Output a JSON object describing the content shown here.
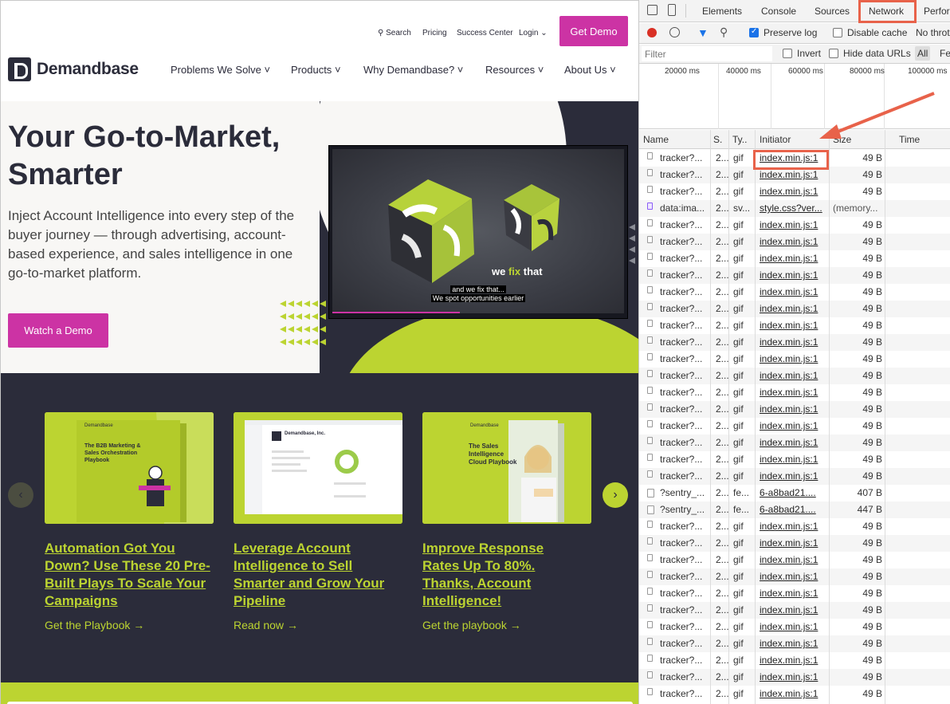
{
  "site": {
    "utility_nav": {
      "search": "Search",
      "pricing": "Pricing",
      "success_center": "Success Center",
      "login": "Login"
    },
    "get_demo_label": "Get Demo",
    "logo_text": "Demandbase",
    "nav": [
      "Problems We Solve",
      "Products",
      "Why Demandbase?",
      "Resources",
      "About Us"
    ],
    "hero": {
      "title": "Your Go-to-Market, Smarter",
      "subtitle": "Inject Account Intelligence into every step of the buyer journey — through advertising, account-based experience, and sales intelligence in one go-to-market platform.",
      "cta": "Watch a Demo"
    },
    "video": {
      "overlay_text_1": "we",
      "overlay_text_2": "fix",
      "overlay_text_3": "that",
      "caption_line_1": "and we fix that...",
      "caption_line_2": "We spot opportunities earlier"
    },
    "cards": [
      {
        "title": "Automation Got You Down? Use These 20 Pre-Built Plays To Scale Your Campaigns",
        "link": "Get the Playbook"
      },
      {
        "title": "Leverage Account Intelligence to Sell Smarter and Grow Your Pipeline",
        "link": "Read now"
      },
      {
        "title": "Improve Response Rates Up To 80%. Thanks, Account Intelligence!",
        "link": "Get the playbook"
      }
    ],
    "card_images": [
      {
        "brand": "Demandbase",
        "heading": "The B2B Marketing & Sales Orchestration Playbook"
      },
      {
        "brand": "Demandbase, Inc."
      },
      {
        "brand": "Demandbase",
        "heading": "The Sales Intelligence Cloud Playbook"
      }
    ]
  },
  "devtools": {
    "tabs": [
      "Elements",
      "Console",
      "Sources",
      "Network",
      "Perfor"
    ],
    "active_tab": "Network",
    "toolbar": {
      "preserve_log": "Preserve log",
      "disable_cache": "Disable cache",
      "throttle": "No throt"
    },
    "filter": {
      "placeholder": "Filter",
      "invert": "Invert",
      "hide_data_urls": "Hide data URLs",
      "all": "All",
      "fe": "Fe"
    },
    "timeline_ticks": [
      "20000 ms",
      "40000 ms",
      "60000 ms",
      "80000 ms",
      "100000 ms"
    ],
    "columns": [
      "Name",
      "S.",
      "Ty..",
      "Initiator",
      "Size",
      "Time"
    ],
    "rows": [
      {
        "name": "tracker?...",
        "status": "2...",
        "type": "gif",
        "initiator": "index.min.js:1",
        "size": "49 B",
        "icon": "image"
      },
      {
        "name": "tracker?...",
        "status": "2...",
        "type": "gif",
        "initiator": "index.min.js:1",
        "size": "49 B",
        "icon": "image"
      },
      {
        "name": "tracker?...",
        "status": "2...",
        "type": "gif",
        "initiator": "index.min.js:1",
        "size": "49 B",
        "icon": "image"
      },
      {
        "name": "data:ima...",
        "status": "2...",
        "type": "sv...",
        "initiator": "style.css?ver...",
        "size": "(memory...",
        "icon": "svg"
      },
      {
        "name": "tracker?...",
        "status": "2...",
        "type": "gif",
        "initiator": "index.min.js:1",
        "size": "49 B",
        "icon": "image"
      },
      {
        "name": "tracker?...",
        "status": "2...",
        "type": "gif",
        "initiator": "index.min.js:1",
        "size": "49 B",
        "icon": "image"
      },
      {
        "name": "tracker?...",
        "status": "2...",
        "type": "gif",
        "initiator": "index.min.js:1",
        "size": "49 B",
        "icon": "image"
      },
      {
        "name": "tracker?...",
        "status": "2...",
        "type": "gif",
        "initiator": "index.min.js:1",
        "size": "49 B",
        "icon": "image"
      },
      {
        "name": "tracker?...",
        "status": "2...",
        "type": "gif",
        "initiator": "index.min.js:1",
        "size": "49 B",
        "icon": "image"
      },
      {
        "name": "tracker?...",
        "status": "2...",
        "type": "gif",
        "initiator": "index.min.js:1",
        "size": "49 B",
        "icon": "image"
      },
      {
        "name": "tracker?...",
        "status": "2...",
        "type": "gif",
        "initiator": "index.min.js:1",
        "size": "49 B",
        "icon": "image"
      },
      {
        "name": "tracker?...",
        "status": "2...",
        "type": "gif",
        "initiator": "index.min.js:1",
        "size": "49 B",
        "icon": "image"
      },
      {
        "name": "tracker?...",
        "status": "2...",
        "type": "gif",
        "initiator": "index.min.js:1",
        "size": "49 B",
        "icon": "image"
      },
      {
        "name": "tracker?...",
        "status": "2...",
        "type": "gif",
        "initiator": "index.min.js:1",
        "size": "49 B",
        "icon": "image"
      },
      {
        "name": "tracker?...",
        "status": "2...",
        "type": "gif",
        "initiator": "index.min.js:1",
        "size": "49 B",
        "icon": "image"
      },
      {
        "name": "tracker?...",
        "status": "2...",
        "type": "gif",
        "initiator": "index.min.js:1",
        "size": "49 B",
        "icon": "image"
      },
      {
        "name": "tracker?...",
        "status": "2...",
        "type": "gif",
        "initiator": "index.min.js:1",
        "size": "49 B",
        "icon": "image"
      },
      {
        "name": "tracker?...",
        "status": "2...",
        "type": "gif",
        "initiator": "index.min.js:1",
        "size": "49 B",
        "icon": "image"
      },
      {
        "name": "tracker?...",
        "status": "2...",
        "type": "gif",
        "initiator": "index.min.js:1",
        "size": "49 B",
        "icon": "image"
      },
      {
        "name": "tracker?...",
        "status": "2...",
        "type": "gif",
        "initiator": "index.min.js:1",
        "size": "49 B",
        "icon": "image"
      },
      {
        "name": "?sentry_...",
        "status": "2...",
        "type": "fe...",
        "initiator": "6-a8bad21....",
        "size": "407 B",
        "icon": "doc"
      },
      {
        "name": "?sentry_...",
        "status": "2...",
        "type": "fe...",
        "initiator": "6-a8bad21....",
        "size": "447 B",
        "icon": "doc"
      },
      {
        "name": "tracker?...",
        "status": "2...",
        "type": "gif",
        "initiator": "index.min.js:1",
        "size": "49 B",
        "icon": "image"
      },
      {
        "name": "tracker?...",
        "status": "2...",
        "type": "gif",
        "initiator": "index.min.js:1",
        "size": "49 B",
        "icon": "image"
      },
      {
        "name": "tracker?...",
        "status": "2...",
        "type": "gif",
        "initiator": "index.min.js:1",
        "size": "49 B",
        "icon": "image"
      },
      {
        "name": "tracker?...",
        "status": "2...",
        "type": "gif",
        "initiator": "index.min.js:1",
        "size": "49 B",
        "icon": "image"
      },
      {
        "name": "tracker?...",
        "status": "2...",
        "type": "gif",
        "initiator": "index.min.js:1",
        "size": "49 B",
        "icon": "image"
      },
      {
        "name": "tracker?...",
        "status": "2...",
        "type": "gif",
        "initiator": "index.min.js:1",
        "size": "49 B",
        "icon": "image"
      },
      {
        "name": "tracker?...",
        "status": "2...",
        "type": "gif",
        "initiator": "index.min.js:1",
        "size": "49 B",
        "icon": "image"
      },
      {
        "name": "tracker?...",
        "status": "2...",
        "type": "gif",
        "initiator": "index.min.js:1",
        "size": "49 B",
        "icon": "image"
      },
      {
        "name": "tracker?...",
        "status": "2...",
        "type": "gif",
        "initiator": "index.min.js:1",
        "size": "49 B",
        "icon": "image"
      },
      {
        "name": "tracker?...",
        "status": "2...",
        "type": "gif",
        "initiator": "index.min.js:1",
        "size": "49 B",
        "icon": "image"
      },
      {
        "name": "tracker?...",
        "status": "2...",
        "type": "gif",
        "initiator": "index.min.js:1",
        "size": "49 B",
        "icon": "image"
      }
    ]
  },
  "colors": {
    "brand_magenta": "#cc33a4",
    "brand_lime": "#bcd431",
    "brand_dark": "#2b2c3a",
    "annotation_orange": "#e8624a",
    "devtools_blue": "#1a73e8"
  }
}
